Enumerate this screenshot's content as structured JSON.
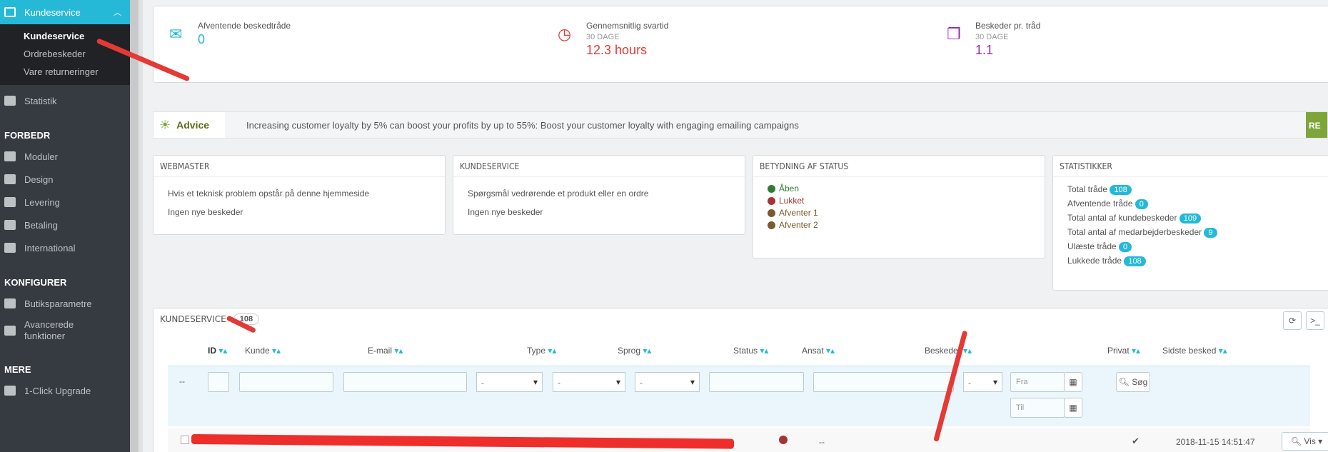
{
  "sidebar": {
    "top": {
      "label": "Kundeservice"
    },
    "sub": [
      "Kundeservice",
      "Ordrebeskeder",
      "Vare returneringer"
    ],
    "statistik": "Statistik",
    "sec1": "FORBEDR",
    "improve": [
      "Moduler",
      "Design",
      "Levering",
      "Betaling",
      "International"
    ],
    "sec2": "KONFIGURER",
    "configure": [
      "Butiksparametre",
      "Avancerede funktioner"
    ],
    "sec3": "MERE",
    "more": [
      "1-Click Upgrade"
    ]
  },
  "kpi": {
    "pending": {
      "label": "Afventende beskedtråde",
      "value": "0"
    },
    "avg": {
      "label": "Gennemsnitlig svartid",
      "sub": "30 DAGE",
      "value": "12.3 hours"
    },
    "permsg": {
      "label": "Beskeder pr. tråd",
      "sub": "30 DAGE",
      "value": "1.1"
    }
  },
  "advice": {
    "tag": "Advice",
    "text": "Increasing customer loyalty by 5% can boost your profits by up to 55%: Boost your customer loyalty with engaging emailing campaigns",
    "cta": "RE"
  },
  "webmaster": {
    "title": "WEBMASTER",
    "line1": "Hvis et teknisk problem opstår på denne hjemmeside",
    "line2": "Ingen nye beskeder"
  },
  "cs": {
    "title": "KUNDESERVICE",
    "line1": "Spørgsmål vedrørende et produkt eller en ordre",
    "line2": "Ingen nye beskeder"
  },
  "statusinfo": {
    "title": "BETYDNING AF STATUS",
    "items": [
      {
        "label": "Åben",
        "color": "#2e7d32"
      },
      {
        "label": "Lukket",
        "color": "#a63434"
      },
      {
        "label": "Afventer 1",
        "color": "#7a5a2e"
      },
      {
        "label": "Afventer 2",
        "color": "#7a5a2e"
      }
    ]
  },
  "stats": {
    "title": "STATISTIKKER",
    "rows": [
      {
        "label": "Total tråde",
        "value": "108"
      },
      {
        "label": "Afventende tråde",
        "value": "0"
      },
      {
        "label": "Total antal af kundebeskeder",
        "value": "109"
      },
      {
        "label": "Total antal af medarbejderbeskeder",
        "value": "9"
      },
      {
        "label": "Ulæste tråde",
        "value": "0"
      },
      {
        "label": "Lukkede tråde",
        "value": "108"
      }
    ]
  },
  "grid": {
    "title": "KUNDESERVICE",
    "count": "108",
    "headers": [
      "ID",
      "Kunde",
      "E-mail",
      "Type",
      "Sprog",
      "Status",
      "Ansat",
      "Beskeder",
      "Privat",
      "Sidste besked"
    ],
    "filters": {
      "select_default": "-",
      "from": "Fra",
      "to": "Til",
      "search": "Søg",
      "dash": "--"
    },
    "row": {
      "ansat": "--",
      "date": "2018-11-15 14:51:47",
      "view": "Vis"
    }
  }
}
